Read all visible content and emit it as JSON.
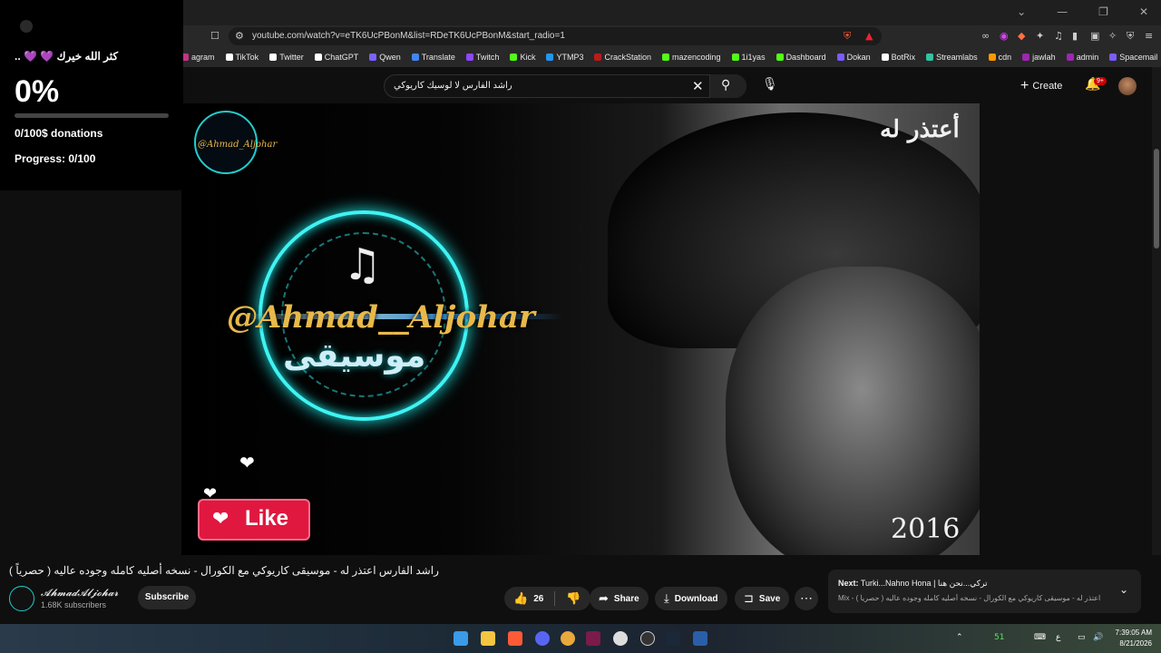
{
  "browser": {
    "window_controls": [
      "⌄",
      "—",
      "❐",
      "✕"
    ],
    "url": "youtube.com/watch?v=eTK6UcPBonM&list=RDeTK6UcPBonM&start_radio=1",
    "bookmarks": [
      {
        "label": "agram",
        "color": "#c13584"
      },
      {
        "label": "TikTok",
        "color": "#ffffff"
      },
      {
        "label": "Twitter",
        "color": "#ffffff"
      },
      {
        "label": "ChatGPT",
        "color": "#ffffff"
      },
      {
        "label": "Qwen",
        "color": "#7b61ff"
      },
      {
        "label": "Translate",
        "color": "#4285f4"
      },
      {
        "label": "Twitch",
        "color": "#9146ff"
      },
      {
        "label": "Kick",
        "color": "#53fc18"
      },
      {
        "label": "YTMP3",
        "color": "#2196f3"
      },
      {
        "label": "CrackStation",
        "color": "#b71c1c"
      },
      {
        "label": "mazencoding",
        "color": "#53fc18"
      },
      {
        "label": "1i1yas",
        "color": "#53fc18"
      },
      {
        "label": "Dashboard",
        "color": "#53fc18"
      },
      {
        "label": "Dokan",
        "color": "#7b5cff"
      },
      {
        "label": "BotRix",
        "color": "#ffffff"
      },
      {
        "label": "Streamlabs",
        "color": "#31c3a2"
      },
      {
        "label": "cdn",
        "color": "#ff9800"
      },
      {
        "label": "jawlah",
        "color": "#9c27b0"
      },
      {
        "label": "admin",
        "color": "#9c27b0"
      },
      {
        "label": "Spacemail",
        "color": "#7b5cff"
      }
    ],
    "bookmarks_more": "»"
  },
  "youtube": {
    "search_query": "راشد الفارس لا لوسيك كاريوكي",
    "create_label": "Create",
    "notif_badge": "9+",
    "video_title": "راشد الفارس اعتذر له - موسيقى كاريوكي مع الكورال - نسخه أصليه كامله وجوده عاليه ( حصرياً )",
    "channel_name": "𝓐𝓱𝓶𝓪𝓭𝓐𝓵𝓳𝓸𝓱𝓪𝓻",
    "channel_subs": "1.68K subscribers",
    "subscribe_label": "Subscribe",
    "like_count": "26",
    "share_label": "Share",
    "download_label": "Download",
    "save_label": "Save",
    "next_label": "Next:",
    "next_title": "Turki...Nahno Hona | تركي...نحن هنا",
    "next_sub": "Mix - راشد الفارس اعتذر له - موسيقى كاريوكي مع الكورال - نسخه أصليه كامله وجوده عاليه ( حصرياً )"
  },
  "video_frame": {
    "song_title": "أعتذر له",
    "year": "2016",
    "handle": "@Ahmad__Aljohar",
    "music_word": "موسيقى",
    "mini_handle": "@Ahmad_Aljohar",
    "like_overlay": "Like"
  },
  "overlay": {
    "thanks": ".. 💜 💜 كثر الله خيرك",
    "percent": "0%",
    "progress_fraction": 0,
    "donations": "0/100$ donations",
    "progress": "Progress: 0/100"
  },
  "taskbar": {
    "time": "7:39:05 AM",
    "date": "8/21/2026",
    "lang": "ع",
    "temp": "51"
  }
}
